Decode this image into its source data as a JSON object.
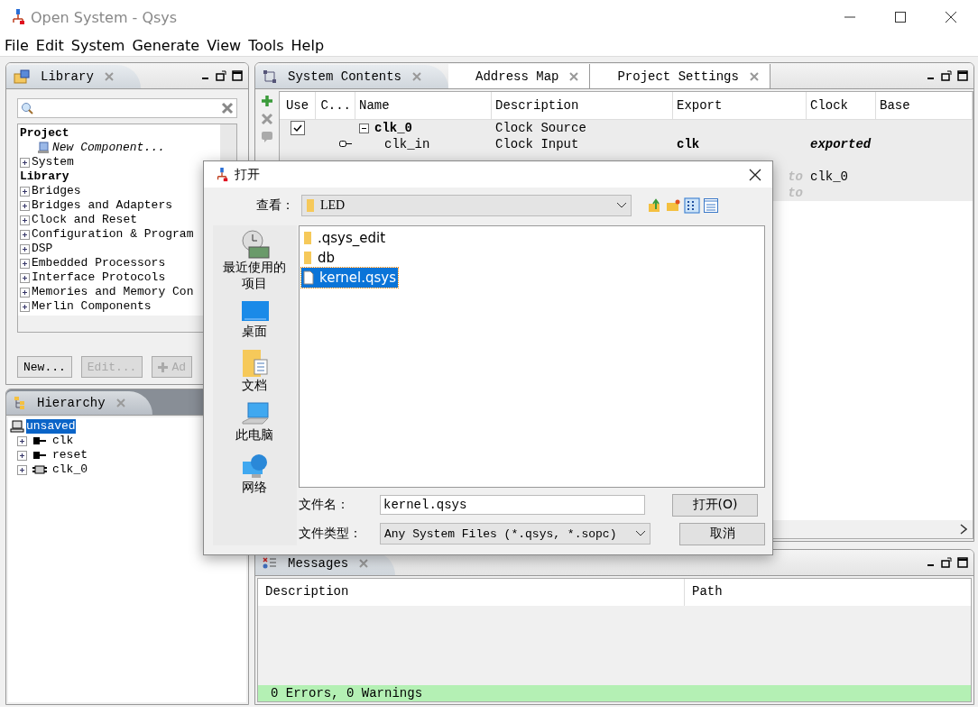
{
  "window": {
    "title": "Open System - Qsys"
  },
  "menu": [
    "File",
    "Edit",
    "System",
    "Generate",
    "View",
    "Tools",
    "Help"
  ],
  "library": {
    "tab": "Library",
    "project_label": "Project",
    "project_items": [
      {
        "label": "New Component...",
        "kind": "component"
      },
      {
        "label": "System",
        "kind": "group"
      }
    ],
    "library_label": "Library",
    "library_items": [
      "Bridges",
      "Bridges and Adapters",
      "Clock and Reset",
      "Configuration & Program",
      "DSP",
      "Embedded Processors",
      "Interface Protocols",
      "Memories and Memory Con",
      "Merlin Components"
    ],
    "buttons": [
      {
        "label": "New...",
        "disabled": false,
        "kind": "plain"
      },
      {
        "label": "Edit...",
        "disabled": true,
        "kind": "plain"
      },
      {
        "label": "Ad",
        "disabled": true,
        "kind": "add"
      }
    ]
  },
  "hierarchy": {
    "tab": "Hierarchy",
    "root": {
      "label": "unsaved",
      "selected": true,
      "children": [
        {
          "label": "clk",
          "kind": "port"
        },
        {
          "label": "reset",
          "kind": "port"
        },
        {
          "label": "clk_0",
          "kind": "module"
        }
      ]
    }
  },
  "system": {
    "tabs": [
      {
        "label": "System Contents",
        "selected": true
      },
      {
        "label": "Address Map",
        "selected": false
      },
      {
        "label": "Project Settings",
        "selected": false
      }
    ],
    "columns": [
      "Use",
      "C...",
      "Name",
      "Description",
      "Export",
      "Clock",
      "Base"
    ],
    "rows": [
      {
        "kind": "module",
        "checked": true,
        "name": "clk_0",
        "description": "Clock Source"
      },
      {
        "kind": "interface",
        "name": "clk_in",
        "description": "Clock Input",
        "export": "clk",
        "clock": "exported"
      },
      {
        "kind": "covered"
      },
      {
        "kind": "hint",
        "export": "to",
        "clock": "clk_0"
      },
      {
        "kind": "hint",
        "export": "to"
      }
    ]
  },
  "messages": {
    "tab": "Messages",
    "columns": [
      "Description",
      "Path"
    ],
    "status": "0 Errors, 0 Warnings"
  },
  "dialog": {
    "title": "打开",
    "look_in_label": "查看：",
    "look_in": "LED",
    "places": [
      {
        "label": "最近使用的项目",
        "kind": "recent"
      },
      {
        "label": "桌面",
        "kind": "desktop"
      },
      {
        "label": "文档",
        "kind": "documents"
      },
      {
        "label": "此电脑",
        "kind": "computer"
      },
      {
        "label": "网络",
        "kind": "network"
      }
    ],
    "files": [
      {
        "name": ".qsys_edit",
        "kind": "folder",
        "selected": false
      },
      {
        "name": "db",
        "kind": "folder",
        "selected": false
      },
      {
        "name": "kernel.qsys",
        "kind": "file",
        "selected": true
      }
    ],
    "filename_label": "文件名：",
    "filename": "kernel.qsys",
    "filetype_label": "文件类型：",
    "filetype": "Any System Files (*.qsys, *.sopc)",
    "buttons": [
      "打开(O)",
      "取消"
    ]
  }
}
